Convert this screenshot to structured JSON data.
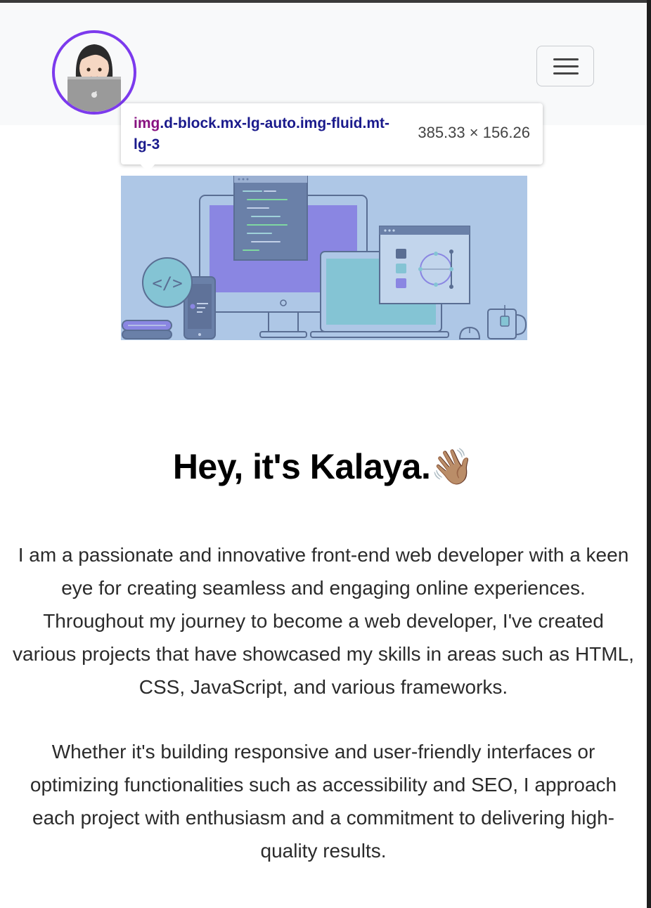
{
  "navbar": {
    "avatar_icon": "woman-technologist-emoji",
    "toggler_icon": "hamburger-menu-icon"
  },
  "devtools_tooltip": {
    "tag": "img",
    "classes": ".d-block.mx-lg-auto.img-fluid.mt-lg-3",
    "size": "385.33 × 156.26"
  },
  "hero": {
    "illustration_icon": "web-devices-illustration"
  },
  "intro": {
    "heading": "Hey, it's Kalaya.",
    "heading_emoji": "👋🏽",
    "paragraph_1": "I am a passionate and innovative front-end web developer with a keen eye for creating seamless and engaging online experiences. Throughout my journey to become a web developer, I've created various projects that have showcased my skills in areas such as HTML, CSS, JavaScript, and various frameworks.",
    "paragraph_2": "Whether it's building responsive and user-friendly interfaces or optimizing functionalities such as accessibility and SEO, I approach each project with enthusiasm and a commitment to delivering high-quality results."
  },
  "colors": {
    "accent": "#7c3aed",
    "navbar_bg": "#f8f9fa",
    "hero_bg": "#aec7e6"
  }
}
